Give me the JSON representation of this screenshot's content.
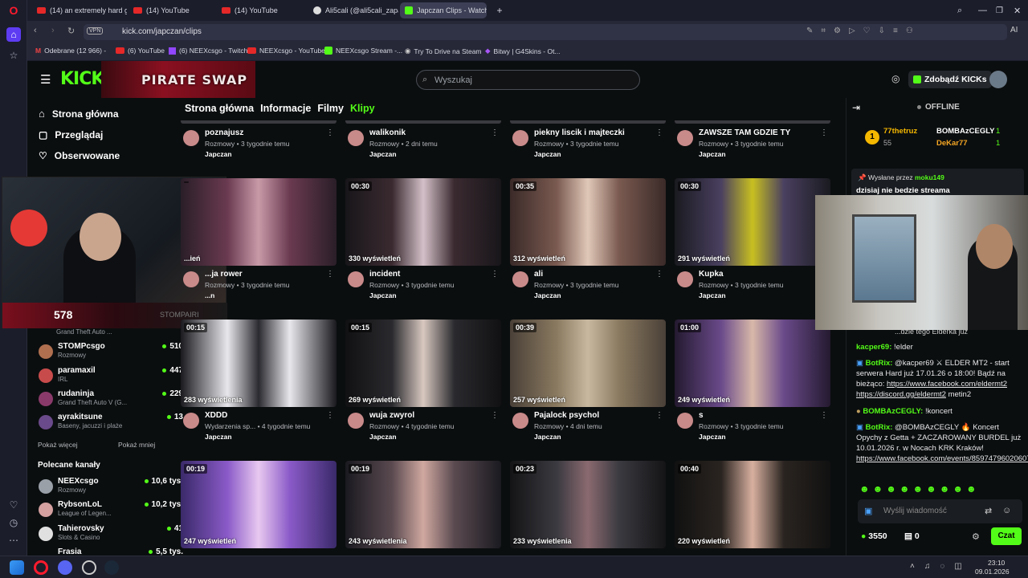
{
  "browser": {
    "tabs": [
      {
        "label": "(14) an extremely hard ga",
        "icon": "youtube-icon"
      },
      {
        "label": "(14) YouTube",
        "icon": "youtube-icon"
      },
      {
        "label": "(14) YouTube",
        "icon": "youtube-icon"
      },
      {
        "label": "Ali5cali (@ali5cali_zapaso",
        "icon": "tiktok-icon"
      },
      {
        "label": "Japczan Clips - Watch Live",
        "icon": "kick-icon"
      }
    ],
    "vpn": "VPN",
    "url": "kick.com/japczan/clips",
    "ai_label": "AI",
    "bookmarks": [
      "Odebrane (12 966) -",
      "(6) YouTube",
      "(6) NEEXcsgo - Twitch",
      "NEEXcsgo - YouTube",
      "NEEXcsgo Stream -...",
      "Try To Drive na Steam",
      "Bitwy | G4Skins - Ot..."
    ]
  },
  "header": {
    "logo": "KICK",
    "banner": "PIRATE SWAP",
    "search_placeholder": "Wyszukaj",
    "kicks_label": "Zdobądź KICKs"
  },
  "sidebar": {
    "nav": [
      "Strona główna",
      "Przeglądaj",
      "Obserwowane"
    ],
    "channels": [
      {
        "name": "STOMPcsgo",
        "category": "Rozmowy",
        "viewers": "510"
      },
      {
        "name": "paramaxil",
        "category": "IRL",
        "viewers": "447"
      },
      {
        "name": "rudaninja",
        "category": "Grand Theft Auto V (G...",
        "viewers": "229"
      },
      {
        "name": "ayrakitsune",
        "category": "Baseny, jacuzzi i plaże",
        "viewers": "13"
      }
    ],
    "partial_category": "Grand Theft Auto ...",
    "show_more": "Pokaż więcej",
    "show_less": "Pokaż mniej",
    "recommended_title": "Polecane kanały",
    "recommended": [
      {
        "name": "NEEXcsgo",
        "category": "Rozmowy",
        "viewers": "10,6 tys."
      },
      {
        "name": "RybsonLoL",
        "category": "League of Legen...",
        "viewers": "10,2 tys."
      },
      {
        "name": "Tahierovsky",
        "category": "Slots & Casino",
        "viewers": "41"
      },
      {
        "name": "Frasia",
        "category": "",
        "viewers": "5,5 tys."
      }
    ],
    "overlay_text": "STOMPAIRI"
  },
  "channel_tabs": [
    "Strona główna",
    "Informacje",
    "Filmy",
    "Klipy"
  ],
  "clips_row0": [
    {
      "title": "poznajusz",
      "sub": "Rozmowy • 3 tygodnie temu",
      "channel": "Japczan"
    },
    {
      "title": "walikonik",
      "sub": "Rozmowy • 2 dni temu",
      "channel": "Japczan"
    },
    {
      "title": "piekny liscik i majteczki",
      "sub": "Rozmowy • 3 tygodnie temu",
      "channel": "Japczan"
    },
    {
      "title": "ZAWSZE TAM GDZIE TY",
      "sub": "Rozmowy • 3 tygodnie temu",
      "channel": "Japczan"
    }
  ],
  "clips_row1": [
    {
      "dur": "",
      "views": "...ień",
      "title": "...ja rower",
      "sub": "Rozmowy • 3 tygodnie temu",
      "channel": "...n"
    },
    {
      "dur": "00:30",
      "views": "330 wyświetleń",
      "title": "incident",
      "sub": "Rozmowy • 3 tygodnie temu",
      "channel": "Japczan"
    },
    {
      "dur": "00:35",
      "views": "312 wyświetleń",
      "title": "ali",
      "sub": "Rozmowy • 3 tygodnie temu",
      "channel": "Japczan"
    },
    {
      "dur": "00:30",
      "views": "291 wyświetleń",
      "title": "Kupka",
      "sub": "Rozmowy • 3 tygodnie temu",
      "channel": "Japczan"
    }
  ],
  "clips_row2": [
    {
      "dur": "00:15",
      "views": "283 wyświetlenia",
      "title": "XDDD",
      "sub": "Wydarzenia sp... • 4 tygodnie temu",
      "channel": "Japczan"
    },
    {
      "dur": "00:15",
      "views": "269 wyświetleń",
      "title": "wuja zwyrol",
      "sub": "Rozmowy • 4 tygodnie temu",
      "channel": "Japczan"
    },
    {
      "dur": "00:39",
      "views": "257 wyświetleń",
      "title": "Pajalock psychol",
      "sub": "Rozmowy • 4 dni temu",
      "channel": "Japczan"
    },
    {
      "dur": "01:00",
      "views": "249 wyświetleń",
      "title": "s",
      "sub": "Rozmowy • 3 tygodnie temu",
      "channel": "Japczan"
    }
  ],
  "clips_row3": [
    {
      "dur": "00:19",
      "views": "247 wyświetleń"
    },
    {
      "dur": "00:19",
      "views": "243 wyświetlenia"
    },
    {
      "dur": "00:23",
      "views": "233 wyświetlenia"
    },
    {
      "dur": "00:40",
      "views": "220 wyświetleń"
    }
  ],
  "chat": {
    "status": "OFFLINE",
    "leaders": [
      {
        "name": "77thetruz",
        "value": "55"
      },
      {
        "name": "BOMBAzCEGLY",
        "value": "1"
      },
      {
        "name": "DeKar77",
        "value": "1"
      }
    ],
    "pinned_by_label": "Wysłane przez",
    "pinned_by": "moku149",
    "pinned_text": "dzisiaj nie bedzie streama",
    "partial_line": "...dzie tego Elderka już",
    "messages": [
      {
        "user": "kacper69:",
        "text": "!elder",
        "link": "",
        "tail": ""
      },
      {
        "user": "BotRix:",
        "text": "@kacper69 ⚔ ELDER MT2 - start serwera Hard już 17.01.26 o 18:00! Bądź na bieżąco:",
        "link": "https://www.facebook.com/eldermt2 https://discord.gg/eldermt2",
        "tail": "metin2"
      },
      {
        "user": "BOMBAzCEGLY:",
        "text": "!koncert",
        "link": "",
        "tail": ""
      },
      {
        "user": "BotRix:",
        "text": "@BOMBAzCEGLY 🔥 Koncert Opychy z Getta + ZACZAROWANY BURDEL już 10.01.2026 r. w Nocach KRK Kraków!",
        "link": "https://www.facebook.com/events/859747960206072",
        "tail": ""
      }
    ],
    "input_placeholder": "Wyślij wiadomość",
    "points": "3550",
    "gifts": "0",
    "send": "Czat"
  },
  "taskbar": {
    "time": "23:10",
    "date": "09.01.2026"
  },
  "colors": {
    "accent": "#53fc18",
    "bg": "#0b0e0f",
    "browser": "#1b1d2b"
  }
}
